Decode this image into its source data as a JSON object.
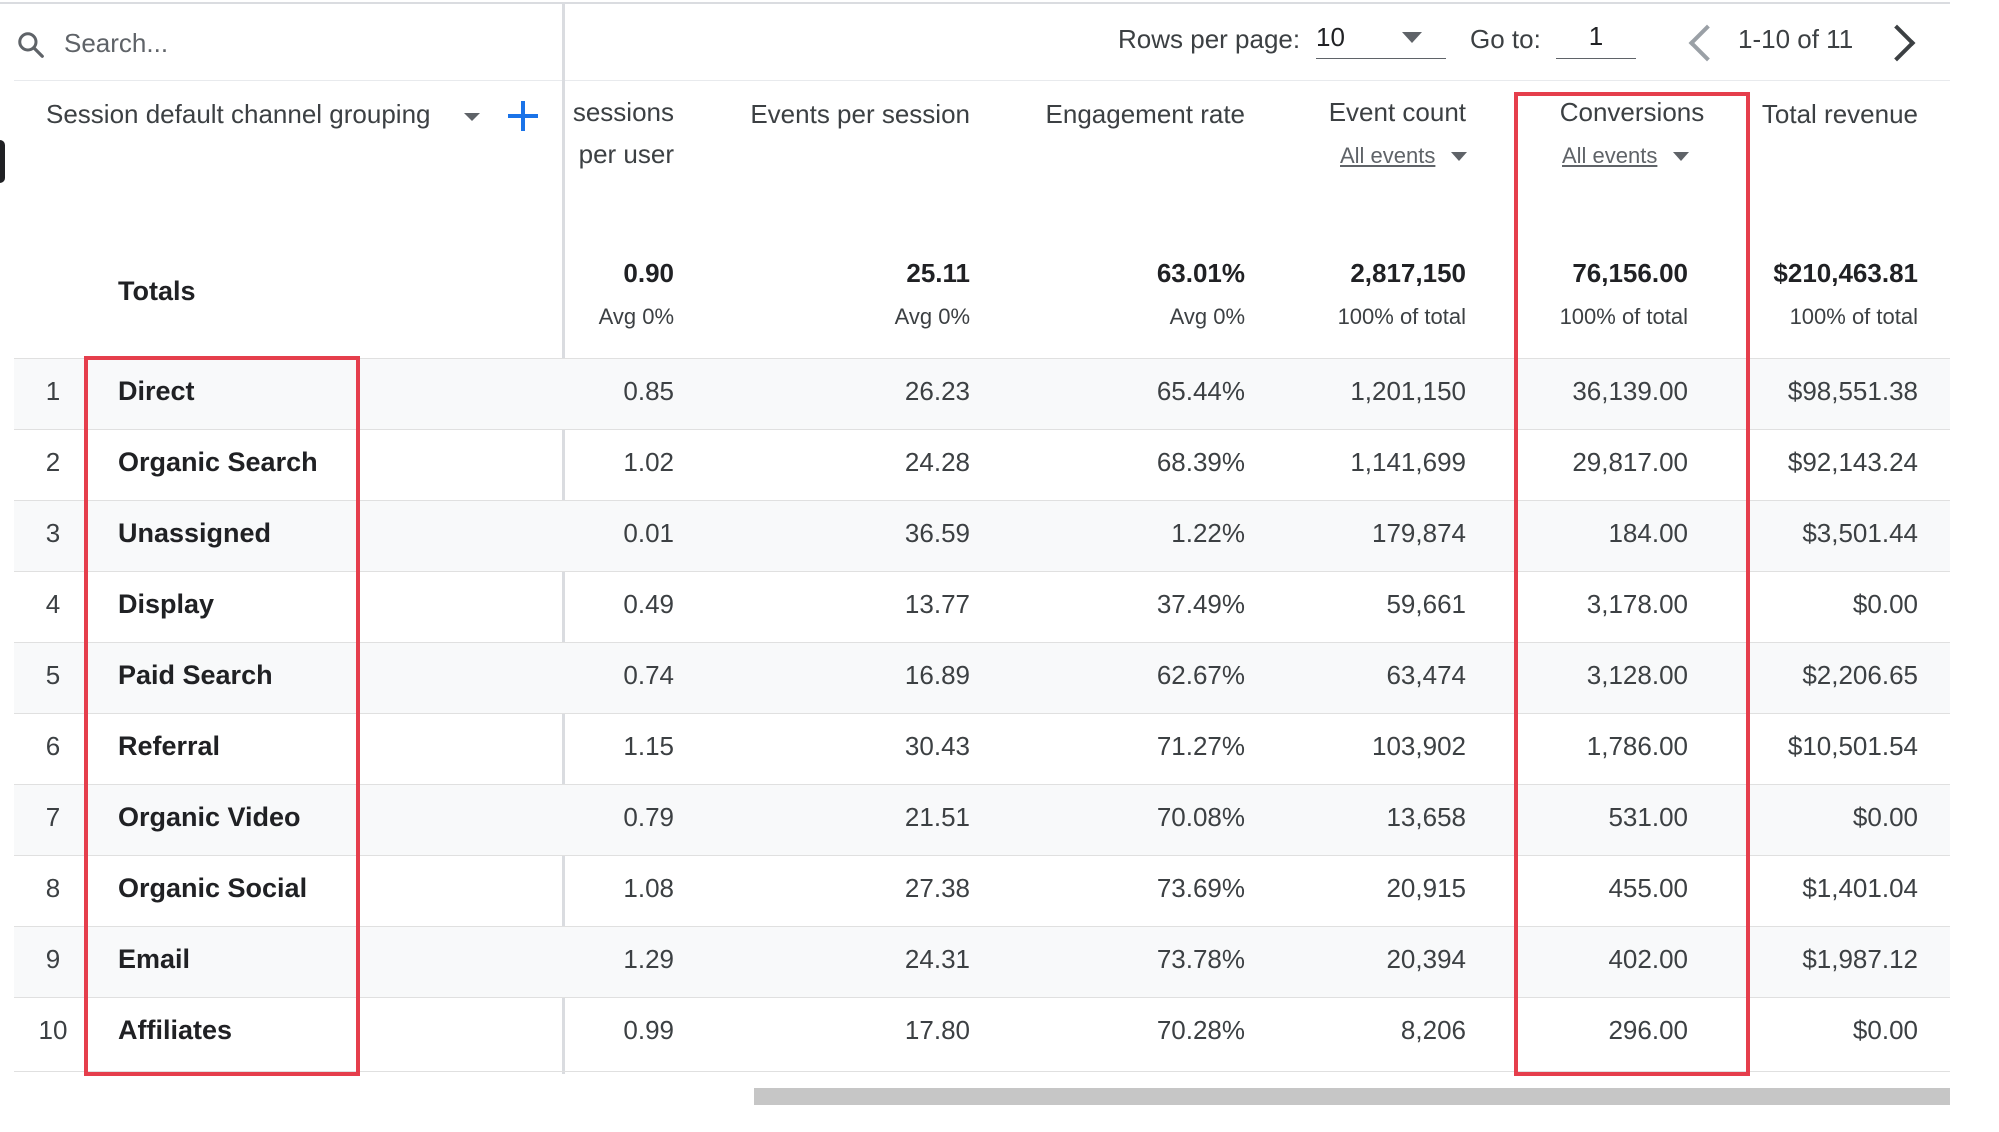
{
  "search": {
    "placeholder": "Search..."
  },
  "pagination": {
    "rows_per_page_label": "Rows per page:",
    "rows_per_page_value": "10",
    "goto_label": "Go to:",
    "goto_value": "1",
    "range_text": "1-10 of 11"
  },
  "columns": {
    "dimension": "Session default channel grouping",
    "sessions_per_user_line1": "sessions",
    "sessions_per_user_line2": "per user",
    "events_per_session": "Events per session",
    "engagement_rate": "Engagement rate",
    "event_count": "Event count",
    "event_count_filter": "All events",
    "conversions": "Conversions",
    "conversions_filter": "All events",
    "total_revenue": "Total revenue"
  },
  "totals": {
    "label": "Totals",
    "sessions_per_user": "0.90",
    "sessions_per_user_sub": "Avg 0%",
    "events_per_session": "25.11",
    "events_per_session_sub": "Avg 0%",
    "engagement_rate": "63.01%",
    "engagement_rate_sub": "Avg 0%",
    "event_count": "2,817,150",
    "event_count_sub": "100% of total",
    "conversions": "76,156.00",
    "conversions_sub": "100% of total",
    "total_revenue": "$210,463.81",
    "total_revenue_sub": "100% of total"
  },
  "rows": [
    {
      "num": "1",
      "channel": "Direct",
      "spu": "0.85",
      "eps": "26.23",
      "er": "65.44%",
      "ec": "1,201,150",
      "conv": "36,139.00",
      "rev": "$98,551.38"
    },
    {
      "num": "2",
      "channel": "Organic Search",
      "spu": "1.02",
      "eps": "24.28",
      "er": "68.39%",
      "ec": "1,141,699",
      "conv": "29,817.00",
      "rev": "$92,143.24"
    },
    {
      "num": "3",
      "channel": "Unassigned",
      "spu": "0.01",
      "eps": "36.59",
      "er": "1.22%",
      "ec": "179,874",
      "conv": "184.00",
      "rev": "$3,501.44"
    },
    {
      "num": "4",
      "channel": "Display",
      "spu": "0.49",
      "eps": "13.77",
      "er": "37.49%",
      "ec": "59,661",
      "conv": "3,178.00",
      "rev": "$0.00"
    },
    {
      "num": "5",
      "channel": "Paid Search",
      "spu": "0.74",
      "eps": "16.89",
      "er": "62.67%",
      "ec": "63,474",
      "conv": "3,128.00",
      "rev": "$2,206.65"
    },
    {
      "num": "6",
      "channel": "Referral",
      "spu": "1.15",
      "eps": "30.43",
      "er": "71.27%",
      "ec": "103,902",
      "conv": "1,786.00",
      "rev": "$10,501.54"
    },
    {
      "num": "7",
      "channel": "Organic Video",
      "spu": "0.79",
      "eps": "21.51",
      "er": "70.08%",
      "ec": "13,658",
      "conv": "531.00",
      "rev": "$0.00"
    },
    {
      "num": "8",
      "channel": "Organic Social",
      "spu": "1.08",
      "eps": "27.38",
      "er": "73.69%",
      "ec": "20,915",
      "conv": "455.00",
      "rev": "$1,401.04"
    },
    {
      "num": "9",
      "channel": "Email",
      "spu": "1.29",
      "eps": "24.31",
      "er": "73.78%",
      "ec": "20,394",
      "conv": "402.00",
      "rev": "$1,987.12"
    },
    {
      "num": "10",
      "channel": "Affiliates",
      "spu": "0.99",
      "eps": "17.80",
      "er": "70.28%",
      "ec": "8,206",
      "conv": "296.00",
      "rev": "$0.00"
    }
  ],
  "colors": {
    "accent": "#1a73e8",
    "highlight": "#e53e4c",
    "row_alt": "#f8f9fa"
  }
}
